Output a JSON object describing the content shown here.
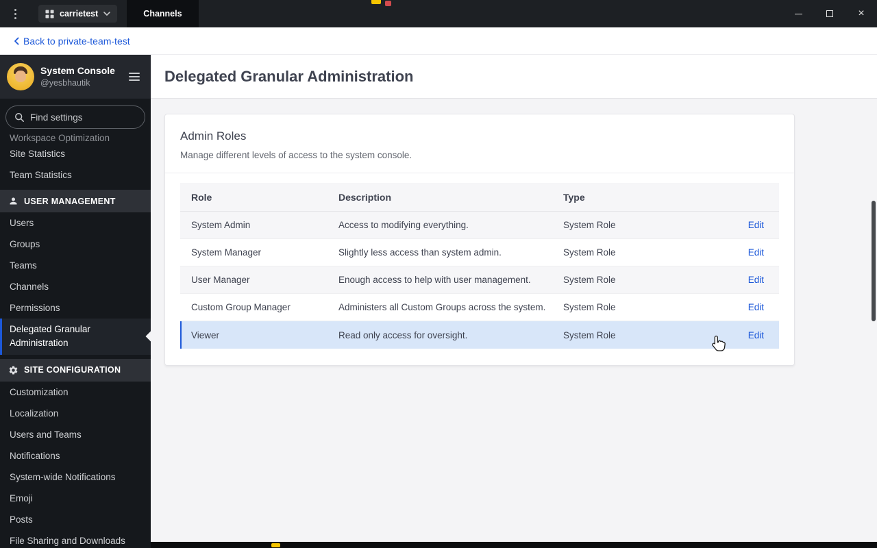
{
  "colors": {
    "accent_blue": "#1c58d9",
    "row_highlight": "#d8e6f9",
    "titlebar_bg": "#1d2024",
    "sidebar_bg": "#15181c"
  },
  "titlebar": {
    "team_name": "carrietest",
    "tab_label": "Channels"
  },
  "back_bar": {
    "label": "Back to private-team-test"
  },
  "sidebar": {
    "header": {
      "title": "System Console",
      "subtitle": "@yesbhautik"
    },
    "search_placeholder": "Find settings",
    "scrolled_item": "Workspace Optimization",
    "top_items": [
      "Site Statistics",
      "Team Statistics"
    ],
    "sections": [
      {
        "label": "USER MANAGEMENT",
        "icon": "people-icon",
        "items": [
          "Users",
          "Groups",
          "Teams",
          "Channels",
          "Permissions",
          "Delegated Granular Administration"
        ],
        "active_item": "Delegated Granular Administration"
      },
      {
        "label": "SITE CONFIGURATION",
        "icon": "gear-icon",
        "items": [
          "Customization",
          "Localization",
          "Users and Teams",
          "Notifications",
          "System-wide Notifications",
          "Emoji",
          "Posts",
          "File Sharing and Downloads"
        ]
      }
    ]
  },
  "main": {
    "page_title": "Delegated Granular Administration",
    "card": {
      "title": "Admin Roles",
      "subtitle": "Manage different levels of access to the system console.",
      "table": {
        "headers": [
          "Role",
          "Description",
          "Type"
        ],
        "rows": [
          {
            "role": "System Admin",
            "description": "Access to modifying everything.",
            "type": "System Role",
            "action": "Edit"
          },
          {
            "role": "System Manager",
            "description": "Slightly less access than system admin.",
            "type": "System Role",
            "action": "Edit"
          },
          {
            "role": "User Manager",
            "description": "Enough access to help with user management.",
            "type": "System Role",
            "action": "Edit"
          },
          {
            "role": "Custom Group Manager",
            "description": "Administers all Custom Groups across the system.",
            "type": "System Role",
            "action": "Edit"
          },
          {
            "role": "Viewer",
            "description": "Read only access for oversight.",
            "type": "System Role",
            "action": "Edit"
          }
        ]
      }
    }
  },
  "icons": {
    "titlebar": [
      "kebab-menu-icon",
      "grid-icon",
      "chevron-down-icon",
      "minimize-icon",
      "maximize-icon",
      "close-icon"
    ],
    "back": "chevron-left-icon",
    "sidebar": [
      "hamburger-icon",
      "magnifier-icon",
      "people-icon",
      "gear-icon"
    ],
    "pointer": "hand-cursor"
  }
}
